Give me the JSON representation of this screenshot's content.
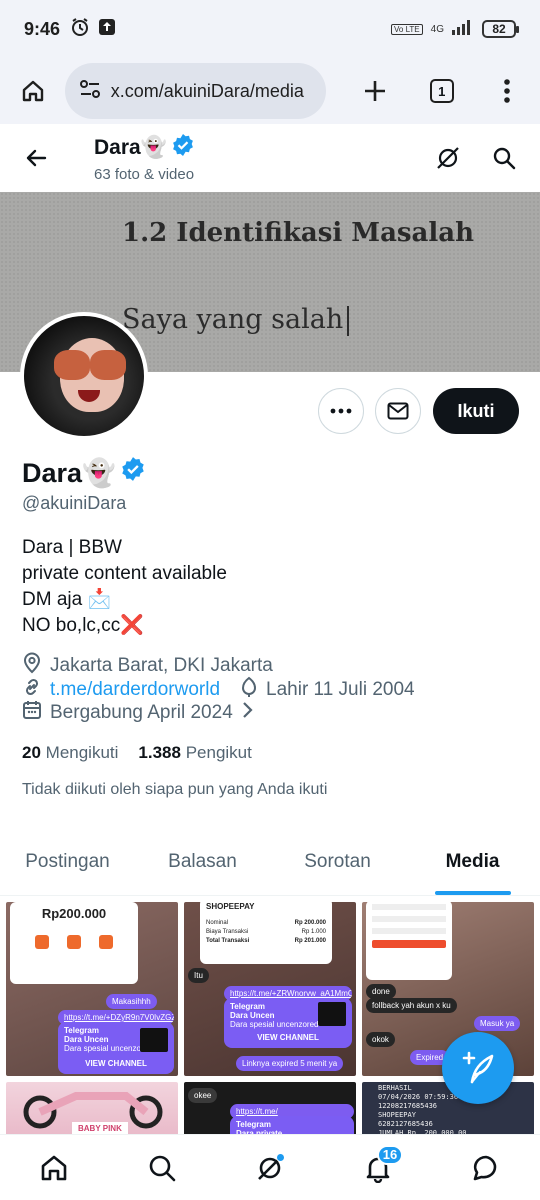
{
  "status_bar": {
    "time": "9:46",
    "network": "4G",
    "volte": "Vo LTE",
    "battery": "82"
  },
  "browser": {
    "url": "x.com/akuiniDara/media",
    "tab_count": "1"
  },
  "header": {
    "name": "Dara👻",
    "subtitle": "63 foto & video"
  },
  "banner": {
    "line1": "1.2 Identifikasi Masalah",
    "line2": "Saya yang salah"
  },
  "profile": {
    "display_name": "Dara👻",
    "handle": "@akuiniDara",
    "follow_label": "Ikuti",
    "bio": [
      "Dara | BBW",
      "private content available",
      "DM aja 📩",
      "NO bo,lc,cc❌"
    ],
    "location": "Jakarta Barat, DKI Jakarta",
    "link": "t.me/darderdorworld",
    "birthday": "Lahir 11 Juli 2004",
    "joined": "Bergabung April 2024",
    "following_count": "20",
    "following_label": "Mengikuti",
    "followers_count": "1.388",
    "followers_label": "Pengikut",
    "follow_note": "Tidak diikuti oleh siapa pun yang Anda ikuti"
  },
  "tabs": [
    {
      "label": "Postingan",
      "active": false
    },
    {
      "label": "Balasan",
      "active": false
    },
    {
      "label": "Sorotan",
      "active": false
    },
    {
      "label": "Media",
      "active": true
    }
  ],
  "media": {
    "m1": {
      "amount": "Rp200.000",
      "bubble": "Makasihhh",
      "link": "https://t.me/+DZyR9n7V0IvZGZI",
      "tg_title": "Telegram",
      "tg_name": "Dara Uncen",
      "tg_desc": "Dara spesial uncenzored",
      "tg_action": "VIEW CHANNEL"
    },
    "m2": {
      "brand": "SHOPEEPAY",
      "row1_label": "Nominal",
      "row1_value": "Rp 200.000",
      "row2_label": "Biaya Transaksi",
      "row2_value": "Rp 1.000",
      "row3_label": "Total Transaksi",
      "row3_value": "Rp 201.000",
      "bubble": "Itu",
      "link": "https://t.me/+ZRWnorvw_aA1MmQ1",
      "tg_title": "Telegram",
      "tg_name": "Dara Uncen",
      "tg_desc": "Dara spesial uncenzored",
      "tg_action": "VIEW CHANNEL",
      "note": "Linknya expired 5 menit ya"
    },
    "m3": {
      "b1": "done",
      "b2": "follback yah akun x ku",
      "b3": "Masuk ya",
      "b4": "okok",
      "b5": "Expired"
    },
    "m4": {
      "label": "BABY PINK"
    },
    "m5": {
      "b1": "okee",
      "link": "https://t.me/",
      "tg_title": "Telegram",
      "tg_name": "Dara private"
    },
    "m6": {
      "l1": "BERHASIL",
      "l2": "07/04/2026 07:59:36",
      "l3": "12208217685436",
      "l4": "SHOPEEPAY",
      "l5": "6282127685436",
      "l6": "JUMLAH Rp. 200.000,00"
    }
  },
  "bottom_nav": {
    "notifications_badge": "16"
  }
}
